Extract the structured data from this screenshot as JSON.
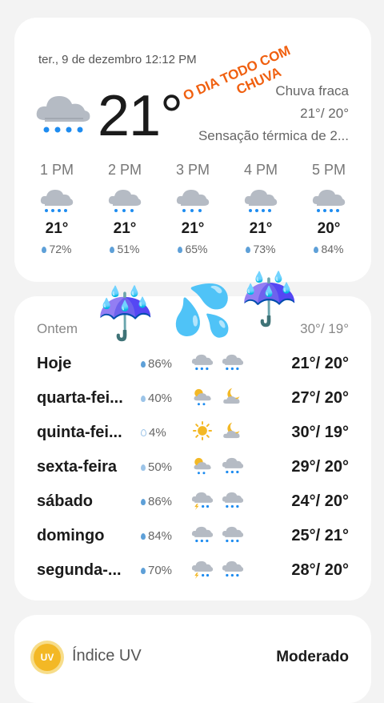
{
  "current": {
    "datetime": "ter., 9 de dezembro 12:12 PM",
    "temperature": "21°",
    "condition": "Chuva fraca",
    "high_low": "21°/ 20°",
    "feels_like": "Sensação térmica de 2..."
  },
  "overlay_text": {
    "line1": "O DIA TODO COM",
    "line2": "CHUVA"
  },
  "hourly": [
    {
      "time": "1 PM",
      "temp": "21°",
      "precip": "72%"
    },
    {
      "time": "2 PM",
      "temp": "21°",
      "precip": "51%"
    },
    {
      "time": "3 PM",
      "temp": "21°",
      "precip": "65%"
    },
    {
      "time": "4 PM",
      "temp": "21°",
      "precip": "73%"
    },
    {
      "time": "5 PM",
      "temp": "20°",
      "precip": "84%"
    }
  ],
  "daily": [
    {
      "day": "Ontem",
      "precip": "",
      "range": "30°/ 19°",
      "icon_day": "",
      "icon_night": ""
    },
    {
      "day": "Hoje",
      "precip": "86%",
      "range": "21°/ 20°",
      "icon_day": "rain-cloud-icon",
      "icon_night": "rain-cloud-icon"
    },
    {
      "day": "quarta-fei...",
      "precip": "40%",
      "range": "27°/ 20°",
      "icon_day": "sun-cloud-rain-icon",
      "icon_night": "moon-cloud-icon"
    },
    {
      "day": "quinta-fei...",
      "precip": "4%",
      "range": "30°/ 19°",
      "icon_day": "sun-icon",
      "icon_night": "moon-cloud-icon"
    },
    {
      "day": "sexta-feira",
      "precip": "50%",
      "range": "29°/ 20°",
      "icon_day": "sun-cloud-rain-icon",
      "icon_night": "rain-cloud-icon"
    },
    {
      "day": "sábado",
      "precip": "86%",
      "range": "24°/ 20°",
      "icon_day": "thunder-cloud-icon",
      "icon_night": "rain-cloud-icon"
    },
    {
      "day": "domingo",
      "precip": "84%",
      "range": "25°/ 21°",
      "icon_day": "rain-cloud-icon",
      "icon_night": "rain-cloud-icon"
    },
    {
      "day": "segunda-...",
      "precip": "70%",
      "range": "28°/ 20°",
      "icon_day": "thunder-cloud-icon",
      "icon_night": "rain-cloud-icon"
    }
  ],
  "uv": {
    "icon_text": "UV",
    "label": "Índice UV",
    "value": "Moderado"
  },
  "colors": {
    "accent_overlay": "#f06010",
    "drop": "#5ea0d8",
    "cloud": "#b5bbc4",
    "sun": "#f3b825"
  }
}
